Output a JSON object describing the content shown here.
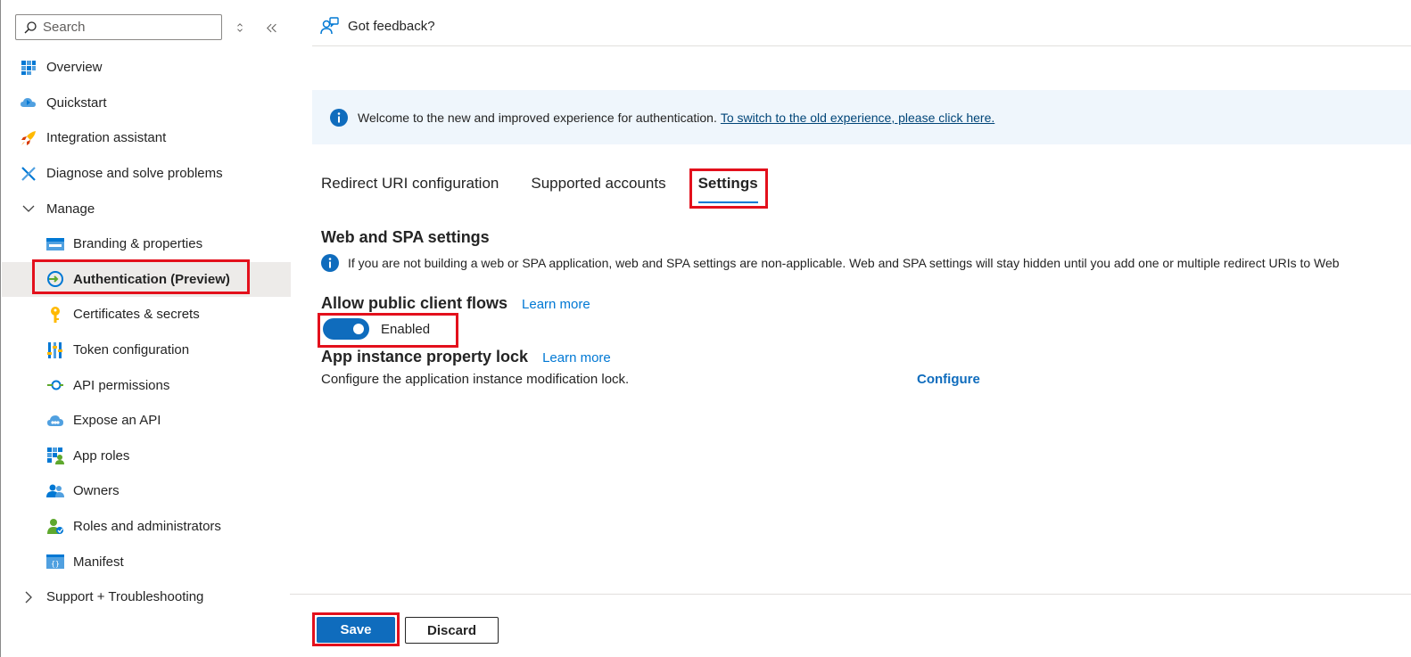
{
  "sidebar": {
    "search_placeholder": "Search",
    "items": [
      {
        "label": "Overview",
        "icon": "overview-icon"
      },
      {
        "label": "Quickstart",
        "icon": "quickstart-icon"
      },
      {
        "label": "Integration assistant",
        "icon": "rocket-icon"
      },
      {
        "label": "Diagnose and solve problems",
        "icon": "wrench-icon"
      },
      {
        "label": "Manage",
        "icon": "chevron-down-icon"
      },
      {
        "label": "Branding & properties",
        "icon": "branding-icon"
      },
      {
        "label": "Authentication (Preview)",
        "icon": "authentication-icon"
      },
      {
        "label": "Certificates & secrets",
        "icon": "key-icon"
      },
      {
        "label": "Token configuration",
        "icon": "token-icon"
      },
      {
        "label": "API permissions",
        "icon": "api-permissions-icon"
      },
      {
        "label": "Expose an API",
        "icon": "cloud-icon"
      },
      {
        "label": "App roles",
        "icon": "app-roles-icon"
      },
      {
        "label": "Owners",
        "icon": "owners-icon"
      },
      {
        "label": "Roles and administrators",
        "icon": "roles-admin-icon"
      },
      {
        "label": "Manifest",
        "icon": "manifest-icon"
      },
      {
        "label": "Support + Troubleshooting",
        "icon": "chevron-right-icon"
      }
    ]
  },
  "header": {
    "feedback_label": "Got feedback?"
  },
  "banner": {
    "text": "Welcome to the new and improved experience for authentication.",
    "link": "To switch to the old experience, please click here."
  },
  "tabs": [
    {
      "label": "Redirect URI configuration"
    },
    {
      "label": "Supported accounts"
    },
    {
      "label": "Settings"
    }
  ],
  "web_spa": {
    "heading": "Web and SPA settings",
    "note": "If you are not building a web or SPA application, web and SPA settings are non-applicable. Web and SPA settings will stay hidden until you add one or multiple redirect URIs to Web"
  },
  "public_flows": {
    "heading": "Allow public client flows",
    "learn_more": "Learn more",
    "toggle_state": "Enabled",
    "toggle_on": true
  },
  "instance_lock": {
    "heading": "App instance property lock",
    "learn_more": "Learn more",
    "description": "Configure the application instance modification lock.",
    "configure": "Configure"
  },
  "footer": {
    "save": "Save",
    "discard": "Discard"
  },
  "colors": {
    "accent": "#0f6cbd",
    "highlight": "#e3101c",
    "banner_bg": "#eff6fc",
    "active_nav_bg": "#edebe9"
  }
}
